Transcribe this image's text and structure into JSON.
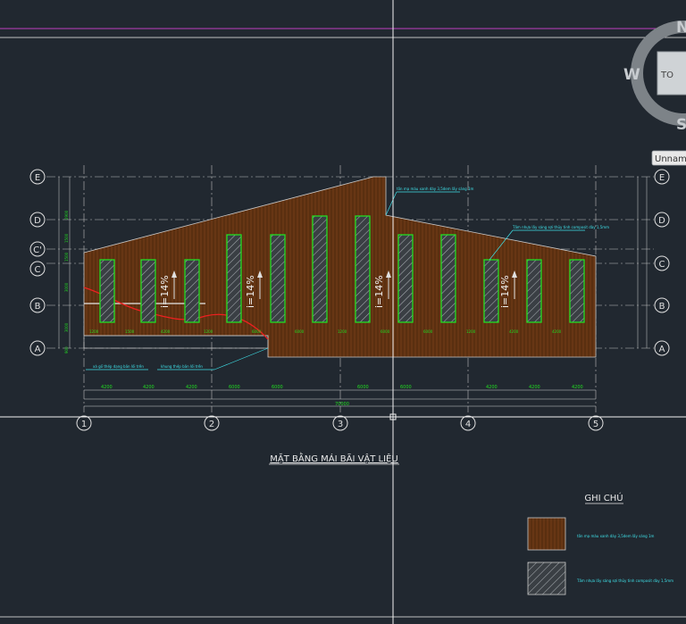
{
  "view_cube": {
    "north": "N",
    "west": "W",
    "south": "S",
    "top": "TO",
    "view_name": "Unnam"
  },
  "drawing": {
    "title": "MẶT BẰNG MÁI BÃI VẬT LIỆU",
    "row_grid": [
      "E",
      "D",
      "C'",
      "C",
      "B",
      "A"
    ],
    "col_grid": [
      "1",
      "2",
      "3",
      "4",
      "5"
    ],
    "slope_labels": [
      "i=14%",
      "i=14%",
      "i=14%",
      "i=14%"
    ],
    "callouts": {
      "roof_sheet": "tôn mạ màu xanh dày 3,5dem lấy sáng 1m",
      "skylight": "Tấm nhựa lấy sáng sợi thủy tinh composit dày 1,5mm",
      "eave_left": "xà gồ thép dạng bản lối trên",
      "eave_right": "khung thép bản lối trên"
    },
    "dims_bottom": [
      "4200",
      "4200",
      "4200",
      "6000",
      "6000",
      "6000",
      "6000",
      "4200",
      "4200",
      "4200"
    ],
    "dims_bottom_total": "70000",
    "dims_left": [
      "2900",
      "1500",
      "1500",
      "3000",
      "3000",
      "900"
    ]
  },
  "legend": {
    "title": "GHI CHÚ",
    "items": [
      {
        "label": "tôn mạ màu xanh dày 3,5dem lấy sáng 1m",
        "symbol": "roof-sheet"
      },
      {
        "label": "Tấm nhựa lấy sáng sợi thủy tinh composit dày 1,5mm",
        "symbol": "skylight"
      }
    ]
  },
  "colors": {
    "background": "#212830",
    "roof_fill": "#5a2f10",
    "skylight_outline": "#22dd22",
    "dimension": "#22dd22",
    "callout": "#3ee0e8",
    "grid": "#c8c8c8",
    "crosshair": "#f2f2f2",
    "magenta_line": "#c040c0",
    "red_line": "#ee2020"
  }
}
